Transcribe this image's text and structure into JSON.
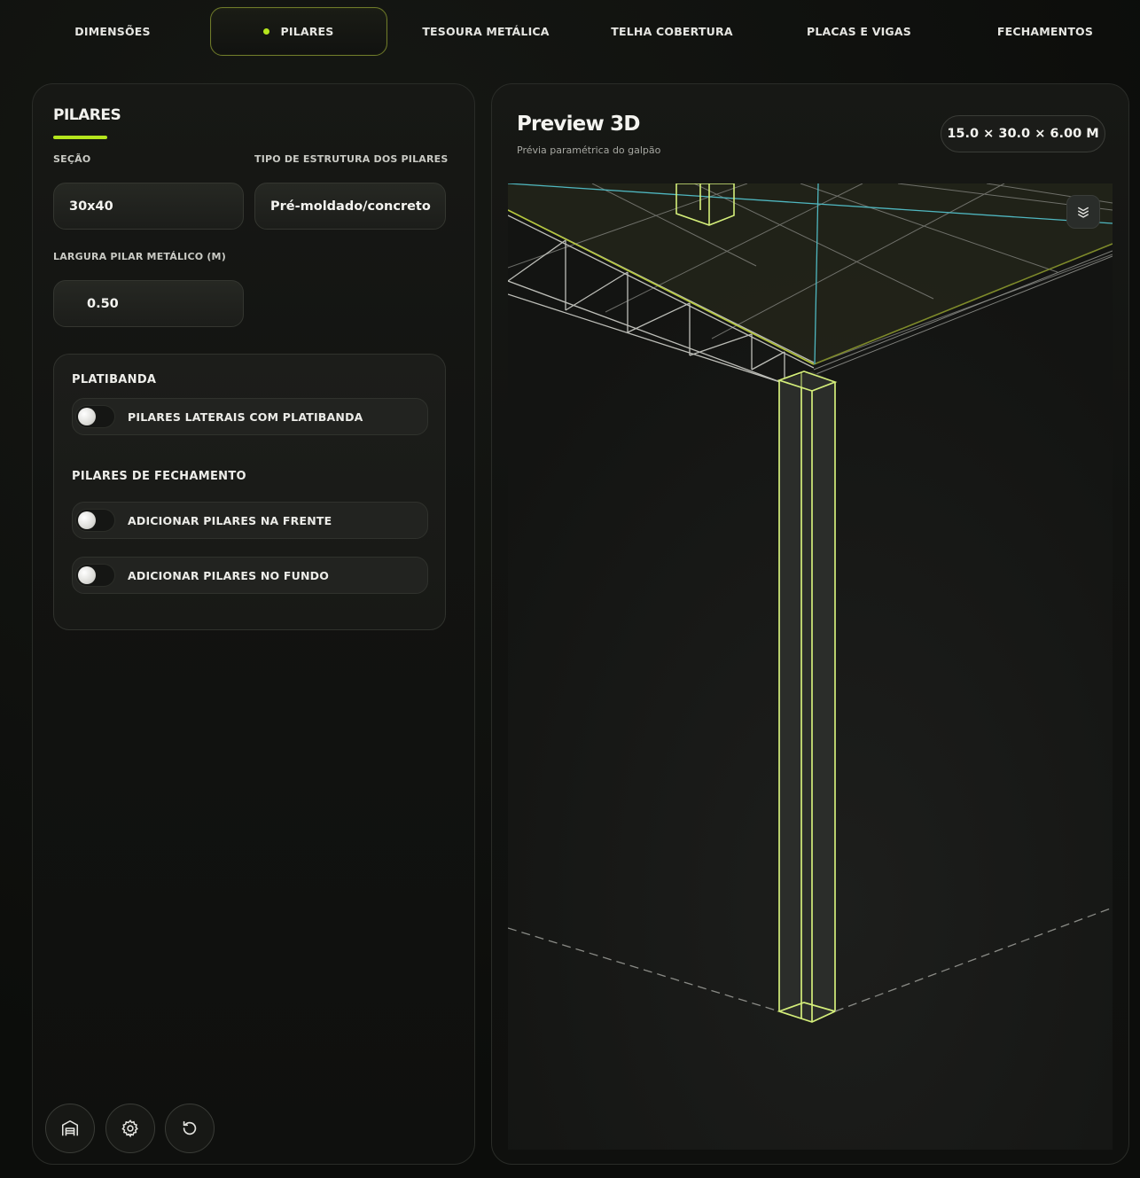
{
  "tabs": [
    {
      "label": "DIMENSÕES",
      "active": false
    },
    {
      "label": "PILARES",
      "active": true
    },
    {
      "label": "TESOURA METÁLICA",
      "active": false
    },
    {
      "label": "TELHA COBERTURA",
      "active": false
    },
    {
      "label": "PLACAS E VIGAS",
      "active": false
    },
    {
      "label": "FECHAMENTOS",
      "active": false
    }
  ],
  "colors": {
    "accent": "#b5e61d",
    "column_outline": "#d4ee7a",
    "axis_line": "#4fb7c0"
  },
  "left": {
    "title": "PILARES",
    "secao": {
      "label": "SEÇÃO",
      "value": "30x40"
    },
    "tipo": {
      "label": "TIPO DE ESTRUTURA DOS PILARES",
      "value": "Pré-moldado/concreto"
    },
    "largura": {
      "label": "LARGURA PILAR METÁLICO (M)",
      "value": "0.50"
    },
    "platibanda": {
      "heading": "PLATIBANDA",
      "toggle": {
        "label": "PILARES LATERAIS COM PLATIBANDA",
        "on": false
      }
    },
    "fechamento": {
      "heading": "PILARES DE FECHAMENTO",
      "toggles": [
        {
          "label": "ADICIONAR PILARES NA FRENTE",
          "on": false
        },
        {
          "label": "ADICIONAR PILARES NO FUNDO",
          "on": false
        }
      ]
    },
    "footer_icons": [
      "warehouse-icon",
      "gear-icon",
      "reset-icon"
    ]
  },
  "preview": {
    "title": "Preview 3D",
    "subtitle": "Prévia paramétrica do galpão",
    "dimensions": "15.0 × 30.0 × 6.00 M",
    "layers_icon": "layers-icon"
  }
}
